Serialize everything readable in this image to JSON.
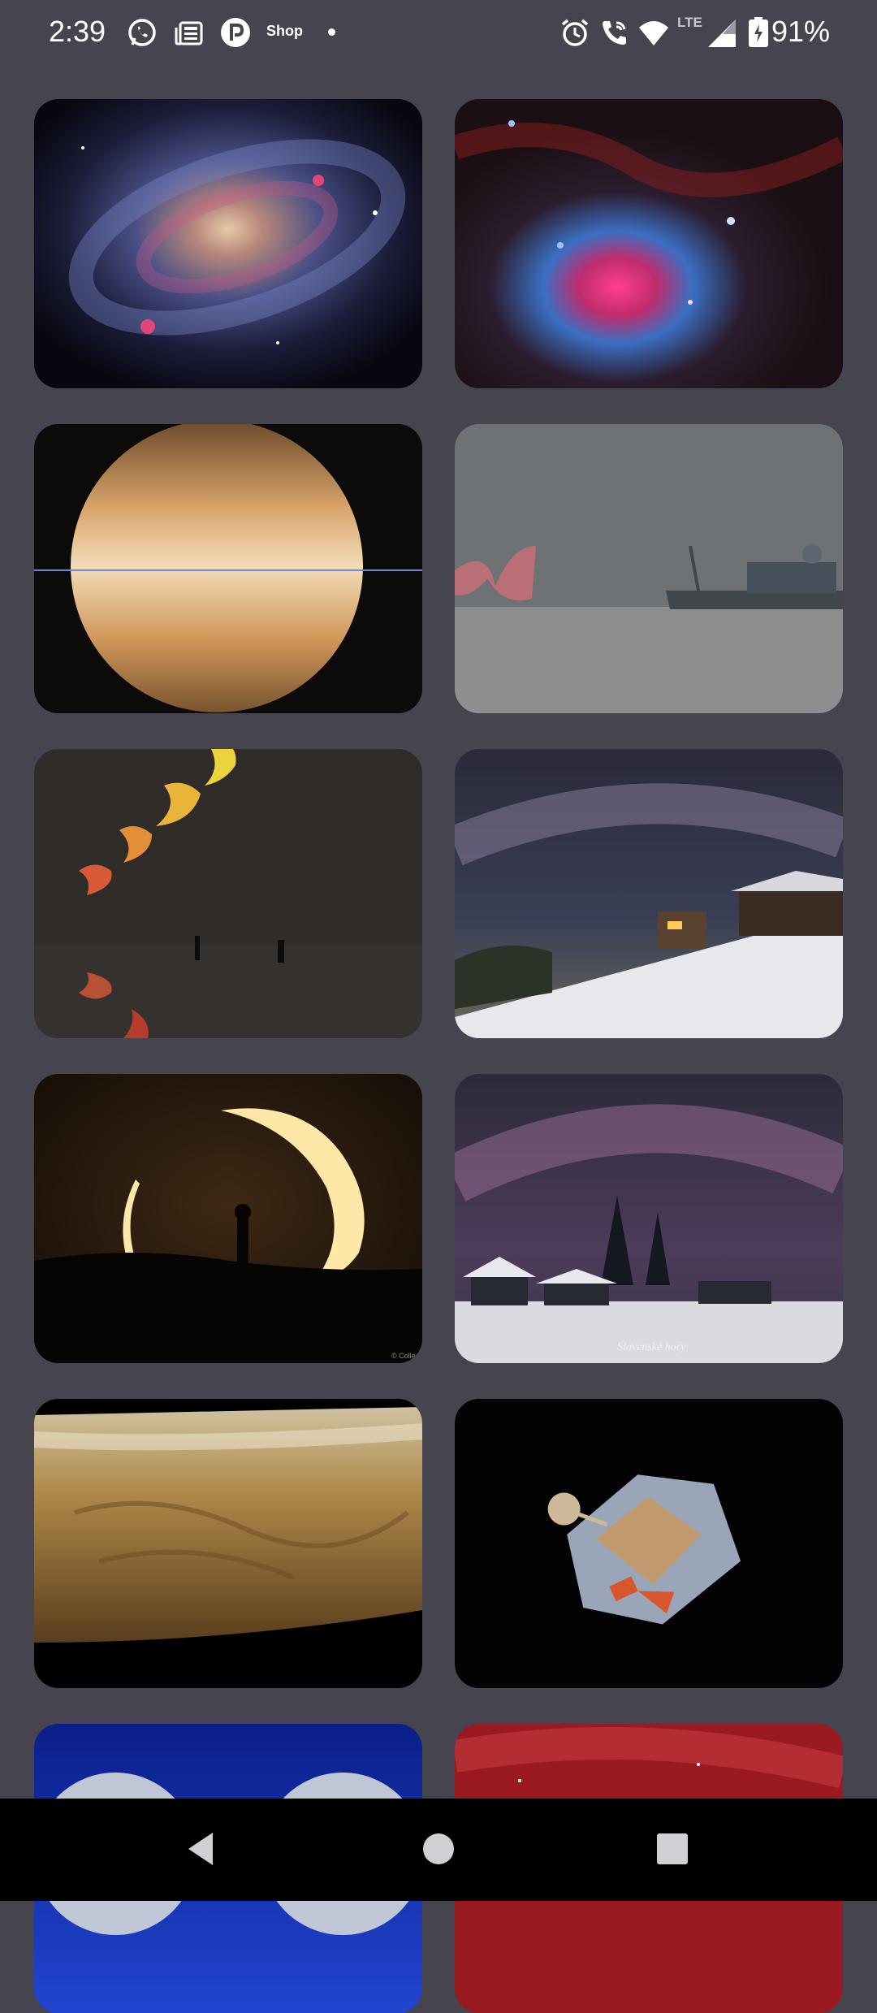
{
  "status_bar": {
    "time": "2:39",
    "shop_label": "Shop",
    "network_label": "LTE",
    "battery_percent": "91%",
    "icons": [
      "whatsapp-icon",
      "news-icon",
      "p-app-icon",
      "alarm-icon",
      "wifi-call-icon",
      "wifi-icon",
      "signal-icon",
      "battery-charging-icon"
    ]
  },
  "gallery": {
    "items": [
      {
        "subject": "spiral galaxy"
      },
      {
        "subject": "nebula"
      },
      {
        "subject": "saturn"
      },
      {
        "subject": "ship and red arcs"
      },
      {
        "subject": "eclipse sequence"
      },
      {
        "subject": "milky way over cabin"
      },
      {
        "subject": "annular eclipse silhouette"
      },
      {
        "subject": "milky way over snowy village"
      },
      {
        "subject": "martian surface"
      },
      {
        "subject": "lunar module"
      },
      {
        "subject": "blue moons"
      },
      {
        "subject": "red nebula"
      }
    ],
    "watermark_1": "© Colleen Pi",
    "watermark_2": "Slovenské hory"
  },
  "nav": {
    "back": "back-icon",
    "home": "home-icon",
    "recents": "recents-icon"
  },
  "colors": {
    "background": "#45444f",
    "nav_bar": "#000000"
  }
}
